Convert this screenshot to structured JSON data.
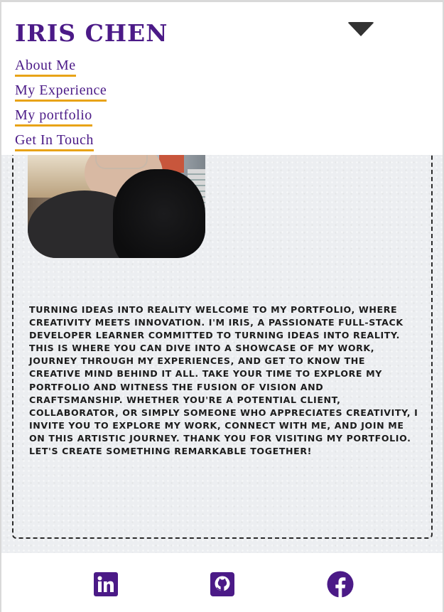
{
  "brand": {
    "name": "IRIS CHEN"
  },
  "nav": {
    "items": [
      {
        "label": "About Me"
      },
      {
        "label": "My Experience"
      },
      {
        "label": "My portfolio"
      },
      {
        "label": "Get In Touch"
      }
    ]
  },
  "about": {
    "intro": "Turning ideas into reality Welcome to my portfolio, where creativity meets innovation. I'm Iris, a passionate full-stack developer learner committed to turning ideas into reality. This is where you can dive into a showcase of my work, journey through my experiences, and get to know the creative mind behind it all. Take your time to explore my portfolio and witness the fusion of vision and craftsmanship. Whether you're a potential client, collaborator, or simply someone who appreciates creativity, I invite you to explore my work, connect with me, and join me on this artistic journey. Thank you for visiting my portfolio. Let's create something remarkable together!"
  },
  "footer": {
    "social": [
      {
        "icon": "linkedin-icon"
      },
      {
        "icon": "github-icon"
      },
      {
        "icon": "facebook-icon"
      }
    ]
  },
  "colors": {
    "brand_purple": "#4b1a87",
    "underline_orange": "#e8a317",
    "text_dark": "#1c1c1c",
    "main_bg": "#eceef1"
  }
}
